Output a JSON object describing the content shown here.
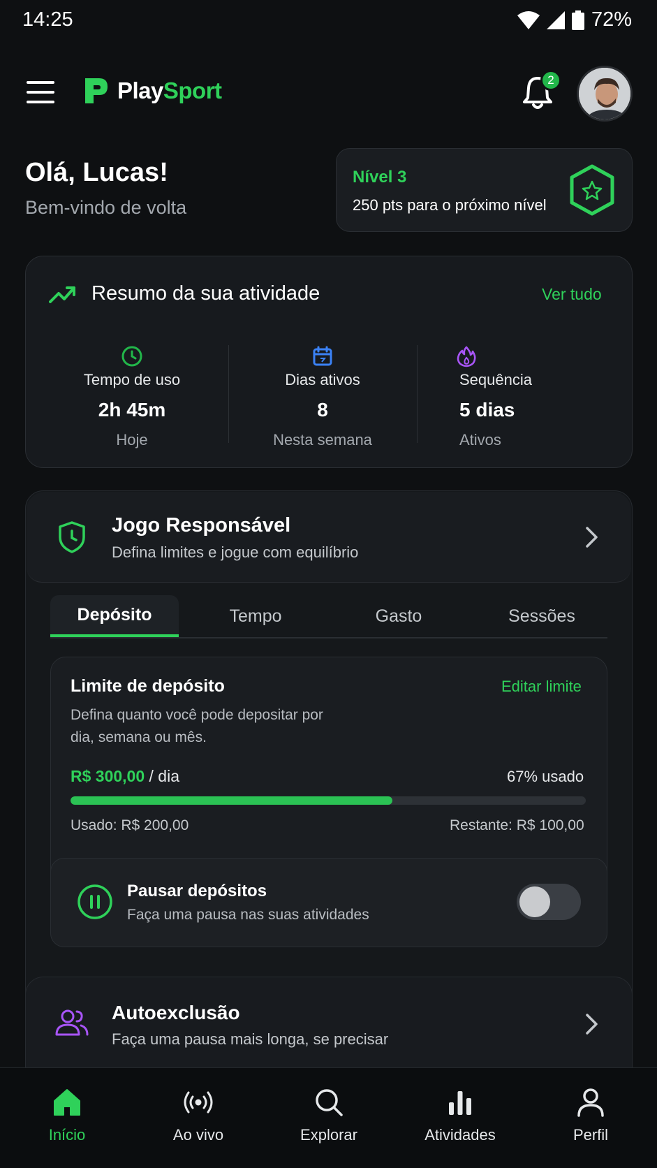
{
  "status_bar": {
    "time": "14:25",
    "battery": "72%"
  },
  "header": {
    "brand_play": "Play",
    "brand_sport": "Sport",
    "notification_count": "2"
  },
  "greeting": {
    "title": "Olá, Lucas!",
    "subtitle": "Bem-vindo de volta"
  },
  "level": {
    "title": "Nível 3",
    "subtitle": "250 pts para o próximo nível"
  },
  "activity": {
    "title": "Resumo da sua atividade",
    "see_all": "Ver tudo",
    "stats": [
      {
        "label": "Tempo de uso",
        "value": "2h 45m",
        "caption": "Hoje",
        "icon": "clock-icon",
        "color": "#22b64a"
      },
      {
        "label": "Dias ativos",
        "value": "8",
        "caption": "Nesta semana",
        "icon": "calendar-icon",
        "color": "#3b82f6"
      },
      {
        "label": "Sequência",
        "value": "5 dias",
        "caption": "Ativos",
        "icon": "flame-icon",
        "color": "#a855f7"
      }
    ]
  },
  "responsible": {
    "title": "Jogo Responsável",
    "subtitle": "Defina limites e jogue com equilíbrio",
    "tabs": [
      "Depósito",
      "Tempo",
      "Gasto",
      "Sessões"
    ],
    "active_tab": 0,
    "limit": {
      "title": "Limite de depósito",
      "edit": "Editar limite",
      "description": "Defina quanto você pode depositar por dia, semana ou mês.",
      "amount": "R$ 300,00",
      "period": " / dia",
      "used_pct_label": "67% usado",
      "used_fraction": 0.625,
      "used": "Usado: R$ 200,00",
      "remaining": "Restante: R$ 100,00"
    },
    "pause": {
      "title": "Pausar depósitos",
      "subtitle": "Faça uma pausa nas suas atividades",
      "enabled": false
    }
  },
  "self_exclusion": {
    "title": "Autoexclusão",
    "subtitle": "Faça uma pausa mais longa, se precisar"
  },
  "bottom_nav": [
    {
      "label": "Início",
      "icon": "home-icon",
      "active": true
    },
    {
      "label": "Ao vivo",
      "icon": "live-icon",
      "active": false
    },
    {
      "label": "Explorar",
      "icon": "search-icon",
      "active": false
    },
    {
      "label": "Atividades",
      "icon": "bar-chart-icon",
      "active": false
    },
    {
      "label": "Perfil",
      "icon": "user-icon",
      "active": false
    }
  ],
  "colors": {
    "accent": "#2fd15a",
    "background": "#0e1012",
    "card": "#171a1e"
  }
}
